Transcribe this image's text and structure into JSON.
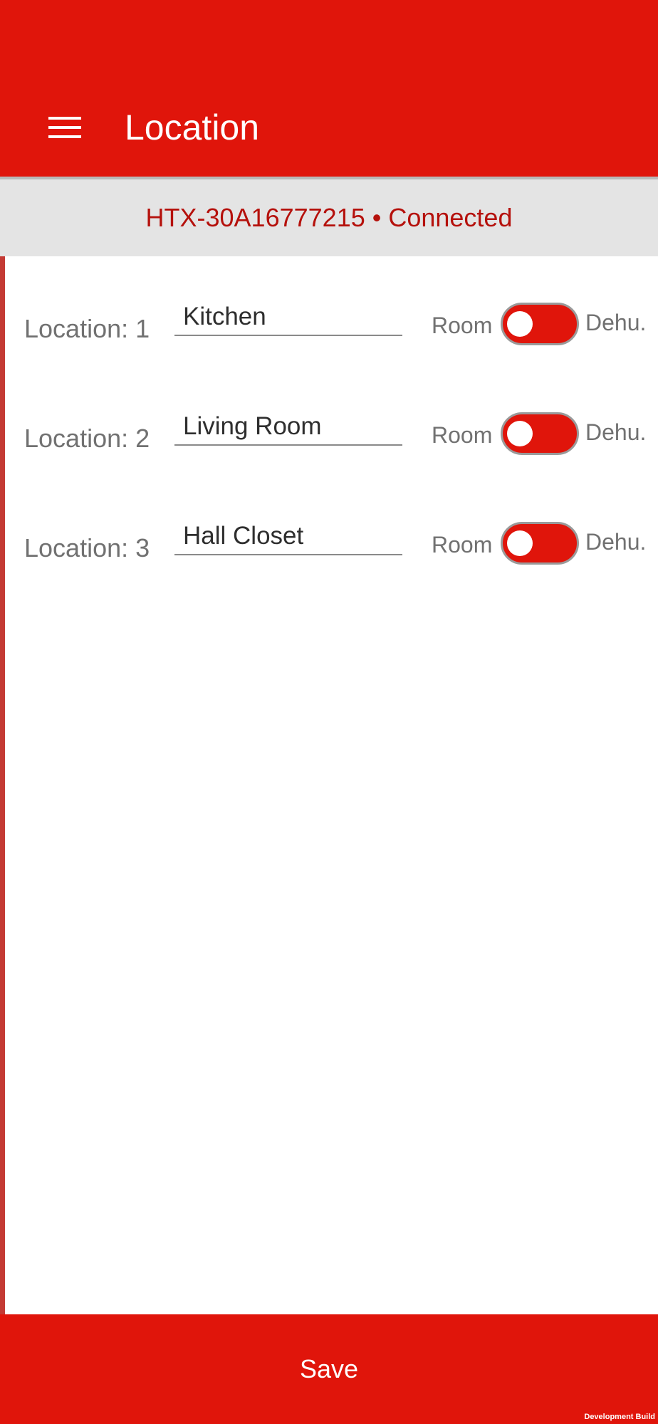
{
  "colors": {
    "primary": "#e0150b",
    "status_background": "#e4e4e4",
    "status_text": "#b5110c",
    "label_text": "#717171",
    "accent_stripe": "#c43a34"
  },
  "header": {
    "menu_icon": "hamburger-menu-icon",
    "title": "Location"
  },
  "status": {
    "text": "HTX-30A16777215 • Connected"
  },
  "locations": [
    {
      "label": "Location: 1",
      "value": "Kitchen",
      "room_label": "Room",
      "dehu_label": "Dehu.",
      "toggle_state": "Dehu."
    },
    {
      "label": "Location: 2",
      "value": "Living Room",
      "room_label": "Room",
      "dehu_label": "Dehu.",
      "toggle_state": "Dehu."
    },
    {
      "label": "Location: 3",
      "value": "Hall Closet",
      "room_label": "Room",
      "dehu_label": "Dehu.",
      "toggle_state": "Dehu."
    }
  ],
  "footer": {
    "save_label": "Save",
    "build_tag": "Development Build"
  }
}
